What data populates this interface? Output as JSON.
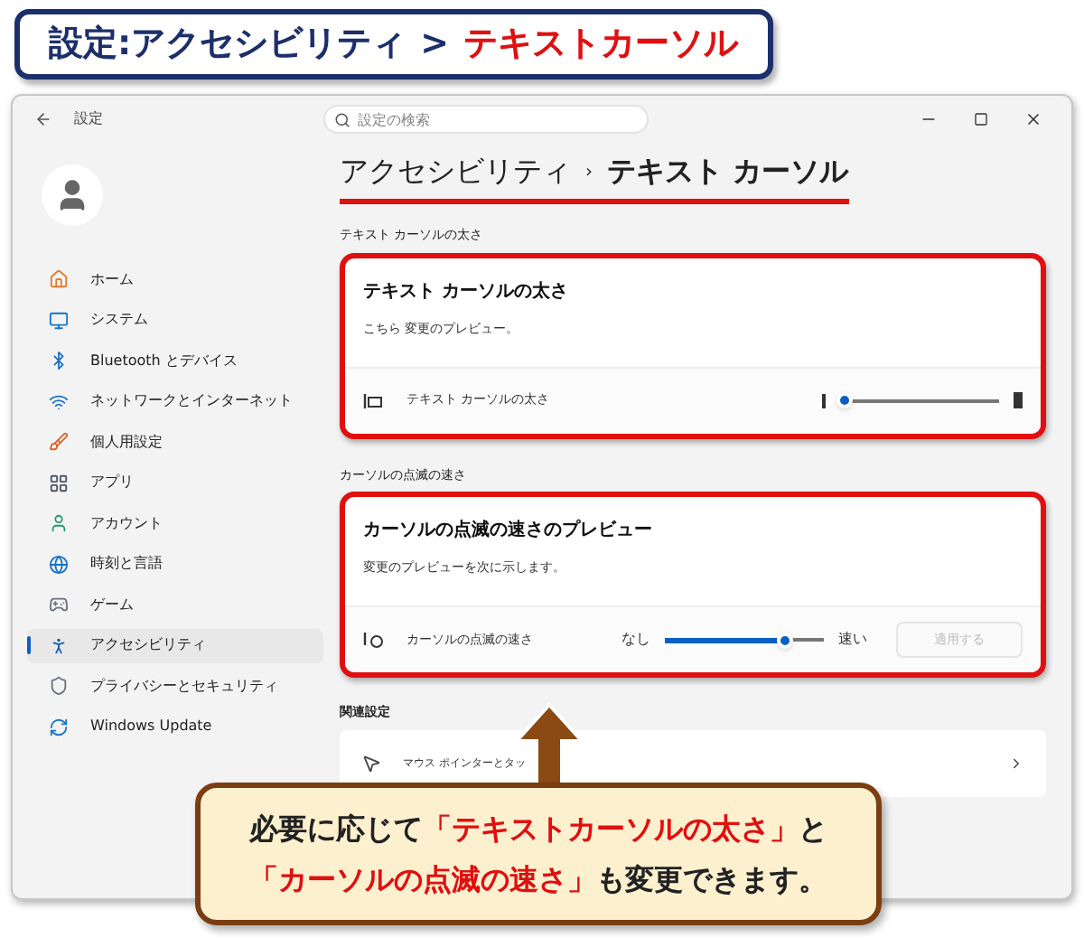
{
  "annotation_title": [
    {
      "text": "設定:アクセシビリティ",
      "highlight": false
    },
    {
      "text": ">",
      "highlight": false
    },
    {
      "text": "テキストカーソル",
      "highlight": true
    }
  ],
  "window": {
    "title": "設定",
    "search": {
      "placeholder": "設定の検索"
    }
  },
  "sidebar": {
    "items": [
      {
        "label": "ホーム",
        "selected": false
      },
      {
        "label": "システム",
        "selected": false
      },
      {
        "label": "Bluetooth とデバイス",
        "selected": false
      },
      {
        "label": "ネットワークとインターネット",
        "selected": false
      },
      {
        "label": "個人用設定",
        "selected": false
      },
      {
        "label": "アプリ",
        "selected": false
      },
      {
        "label": "アカウント",
        "selected": false
      },
      {
        "label": "時刻と言語",
        "selected": false
      },
      {
        "label": "ゲーム",
        "selected": false
      },
      {
        "label": "アクセシビリティ",
        "selected": true
      },
      {
        "label": "プライバシーとセキュリティ",
        "selected": false
      },
      {
        "label": "Windows Update",
        "selected": false
      }
    ]
  },
  "breadcrumb": {
    "parent": "アクセシビリティ",
    "separator": "›",
    "current": "テキスト カーソル"
  },
  "sections": [
    {
      "heading": "テキスト カーソルの太さ",
      "card_title": "テキスト カーソルの太さ",
      "preview": "こちら 変更のプレビュー。",
      "setting_label": "テキスト カーソルの太さ",
      "kind": "thickness",
      "level": 0.02
    },
    {
      "heading": "カーソルの点滅の速さ",
      "card_title": "カーソルの点滅の速さのプレビュー",
      "preview": "変更のプレビューを次に示します。",
      "setting_label": "カーソルの点滅の速さ",
      "kind": "blink",
      "min_label": "なし",
      "max_label": "速い",
      "level": 0.75,
      "button": {
        "label": "適用する",
        "disabled": true
      }
    }
  ],
  "related": {
    "heading": "関連設定",
    "items": [
      {
        "label": "マウス ポインターとタッ"
      }
    ]
  },
  "callout": [
    {
      "text": "必要に応じて",
      "highlight": false
    },
    {
      "text": "「テキストカーソルの太さ」",
      "highlight": true
    },
    {
      "text": "と",
      "highlight": false
    },
    {
      "text": "「カーソルの点滅の速さ」",
      "highlight": true
    },
    {
      "text": "も変更できます。",
      "highlight": false
    }
  ]
}
